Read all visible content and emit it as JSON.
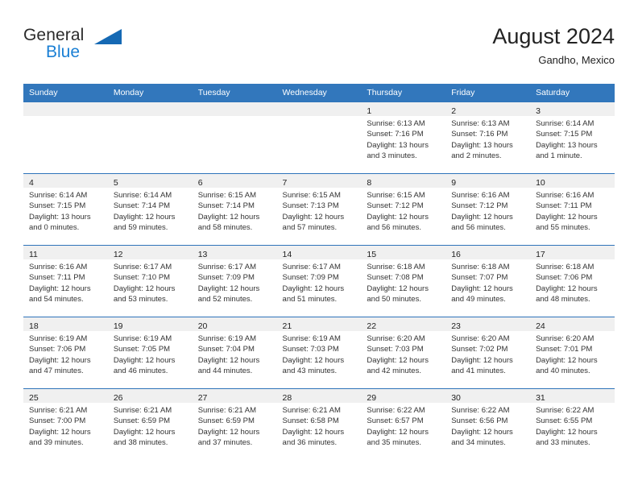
{
  "brand": {
    "name_part1": "General",
    "name_part2": "Blue",
    "flag_icon": "triangle-flag-icon"
  },
  "header": {
    "title": "August 2024",
    "subtitle": "Gandho, Mexico"
  },
  "colors": {
    "header_blue": "#3277bc",
    "row_divider": "#2f74ba",
    "daynum_band": "#f0f0f0",
    "brand_blue": "#1a7fd4"
  },
  "weekday_headers": [
    "Sunday",
    "Monday",
    "Tuesday",
    "Wednesday",
    "Thursday",
    "Friday",
    "Saturday"
  ],
  "weeks": [
    [
      {
        "day": "",
        "lines": []
      },
      {
        "day": "",
        "lines": []
      },
      {
        "day": "",
        "lines": []
      },
      {
        "day": "",
        "lines": []
      },
      {
        "day": "1",
        "lines": [
          "Sunrise: 6:13 AM",
          "Sunset: 7:16 PM",
          "Daylight: 13 hours",
          "and 3 minutes."
        ]
      },
      {
        "day": "2",
        "lines": [
          "Sunrise: 6:13 AM",
          "Sunset: 7:16 PM",
          "Daylight: 13 hours",
          "and 2 minutes."
        ]
      },
      {
        "day": "3",
        "lines": [
          "Sunrise: 6:14 AM",
          "Sunset: 7:15 PM",
          "Daylight: 13 hours",
          "and 1 minute."
        ]
      }
    ],
    [
      {
        "day": "4",
        "lines": [
          "Sunrise: 6:14 AM",
          "Sunset: 7:15 PM",
          "Daylight: 13 hours",
          "and 0 minutes."
        ]
      },
      {
        "day": "5",
        "lines": [
          "Sunrise: 6:14 AM",
          "Sunset: 7:14 PM",
          "Daylight: 12 hours",
          "and 59 minutes."
        ]
      },
      {
        "day": "6",
        "lines": [
          "Sunrise: 6:15 AM",
          "Sunset: 7:14 PM",
          "Daylight: 12 hours",
          "and 58 minutes."
        ]
      },
      {
        "day": "7",
        "lines": [
          "Sunrise: 6:15 AM",
          "Sunset: 7:13 PM",
          "Daylight: 12 hours",
          "and 57 minutes."
        ]
      },
      {
        "day": "8",
        "lines": [
          "Sunrise: 6:15 AM",
          "Sunset: 7:12 PM",
          "Daylight: 12 hours",
          "and 56 minutes."
        ]
      },
      {
        "day": "9",
        "lines": [
          "Sunrise: 6:16 AM",
          "Sunset: 7:12 PM",
          "Daylight: 12 hours",
          "and 56 minutes."
        ]
      },
      {
        "day": "10",
        "lines": [
          "Sunrise: 6:16 AM",
          "Sunset: 7:11 PM",
          "Daylight: 12 hours",
          "and 55 minutes."
        ]
      }
    ],
    [
      {
        "day": "11",
        "lines": [
          "Sunrise: 6:16 AM",
          "Sunset: 7:11 PM",
          "Daylight: 12 hours",
          "and 54 minutes."
        ]
      },
      {
        "day": "12",
        "lines": [
          "Sunrise: 6:17 AM",
          "Sunset: 7:10 PM",
          "Daylight: 12 hours",
          "and 53 minutes."
        ]
      },
      {
        "day": "13",
        "lines": [
          "Sunrise: 6:17 AM",
          "Sunset: 7:09 PM",
          "Daylight: 12 hours",
          "and 52 minutes."
        ]
      },
      {
        "day": "14",
        "lines": [
          "Sunrise: 6:17 AM",
          "Sunset: 7:09 PM",
          "Daylight: 12 hours",
          "and 51 minutes."
        ]
      },
      {
        "day": "15",
        "lines": [
          "Sunrise: 6:18 AM",
          "Sunset: 7:08 PM",
          "Daylight: 12 hours",
          "and 50 minutes."
        ]
      },
      {
        "day": "16",
        "lines": [
          "Sunrise: 6:18 AM",
          "Sunset: 7:07 PM",
          "Daylight: 12 hours",
          "and 49 minutes."
        ]
      },
      {
        "day": "17",
        "lines": [
          "Sunrise: 6:18 AM",
          "Sunset: 7:06 PM",
          "Daylight: 12 hours",
          "and 48 minutes."
        ]
      }
    ],
    [
      {
        "day": "18",
        "lines": [
          "Sunrise: 6:19 AM",
          "Sunset: 7:06 PM",
          "Daylight: 12 hours",
          "and 47 minutes."
        ]
      },
      {
        "day": "19",
        "lines": [
          "Sunrise: 6:19 AM",
          "Sunset: 7:05 PM",
          "Daylight: 12 hours",
          "and 46 minutes."
        ]
      },
      {
        "day": "20",
        "lines": [
          "Sunrise: 6:19 AM",
          "Sunset: 7:04 PM",
          "Daylight: 12 hours",
          "and 44 minutes."
        ]
      },
      {
        "day": "21",
        "lines": [
          "Sunrise: 6:19 AM",
          "Sunset: 7:03 PM",
          "Daylight: 12 hours",
          "and 43 minutes."
        ]
      },
      {
        "day": "22",
        "lines": [
          "Sunrise: 6:20 AM",
          "Sunset: 7:03 PM",
          "Daylight: 12 hours",
          "and 42 minutes."
        ]
      },
      {
        "day": "23",
        "lines": [
          "Sunrise: 6:20 AM",
          "Sunset: 7:02 PM",
          "Daylight: 12 hours",
          "and 41 minutes."
        ]
      },
      {
        "day": "24",
        "lines": [
          "Sunrise: 6:20 AM",
          "Sunset: 7:01 PM",
          "Daylight: 12 hours",
          "and 40 minutes."
        ]
      }
    ],
    [
      {
        "day": "25",
        "lines": [
          "Sunrise: 6:21 AM",
          "Sunset: 7:00 PM",
          "Daylight: 12 hours",
          "and 39 minutes."
        ]
      },
      {
        "day": "26",
        "lines": [
          "Sunrise: 6:21 AM",
          "Sunset: 6:59 PM",
          "Daylight: 12 hours",
          "and 38 minutes."
        ]
      },
      {
        "day": "27",
        "lines": [
          "Sunrise: 6:21 AM",
          "Sunset: 6:59 PM",
          "Daylight: 12 hours",
          "and 37 minutes."
        ]
      },
      {
        "day": "28",
        "lines": [
          "Sunrise: 6:21 AM",
          "Sunset: 6:58 PM",
          "Daylight: 12 hours",
          "and 36 minutes."
        ]
      },
      {
        "day": "29",
        "lines": [
          "Sunrise: 6:22 AM",
          "Sunset: 6:57 PM",
          "Daylight: 12 hours",
          "and 35 minutes."
        ]
      },
      {
        "day": "30",
        "lines": [
          "Sunrise: 6:22 AM",
          "Sunset: 6:56 PM",
          "Daylight: 12 hours",
          "and 34 minutes."
        ]
      },
      {
        "day": "31",
        "lines": [
          "Sunrise: 6:22 AM",
          "Sunset: 6:55 PM",
          "Daylight: 12 hours",
          "and 33 minutes."
        ]
      }
    ]
  ]
}
